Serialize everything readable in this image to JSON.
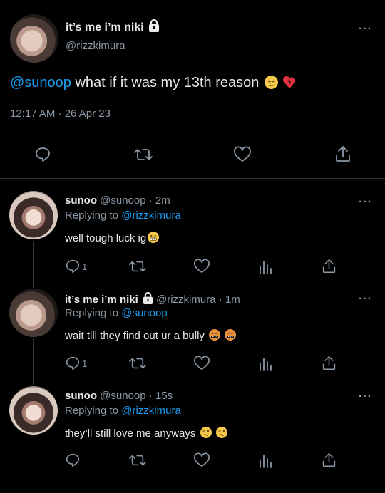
{
  "main_tweet": {
    "display_name": "it’s me i’m niki",
    "handle": "@rizzkimura",
    "mention": "@sunoop",
    "text": " what if it was my 13th reason",
    "timestamp": "12:17 AM · 26 Apr 23",
    "more": "···",
    "icons": [
      "lock-icon",
      "reply-icon",
      "retweet-icon",
      "like-icon",
      "share-icon"
    ]
  },
  "replies": [
    {
      "display_name": "sunoo",
      "meta": " @sunoop · 2m",
      "replying_label": "Replying to ",
      "replying_to": "@rizzkimura",
      "text": "well tough luck ig",
      "reply_count": "1",
      "more": "···"
    },
    {
      "display_name": "it’s me i’m niki",
      "meta": " @rizzkimura · 1m",
      "replying_label": "Replying to ",
      "replying_to": "@sunoop",
      "text": "wait till they find out ur a bully",
      "reply_count": "1",
      "more": "···"
    },
    {
      "display_name": "sunoo",
      "meta": " @sunoop · 15s",
      "replying_label": "Replying to ",
      "replying_to": "@rizzkimura",
      "text": "they’ll still love me anyways",
      "reply_count": "",
      "more": "···"
    }
  ],
  "colors": {
    "background": "#000000",
    "accent": "#1d9bf0",
    "muted": "#8b98a5",
    "text": "#e7e9ea",
    "divider": "#2f3336"
  }
}
